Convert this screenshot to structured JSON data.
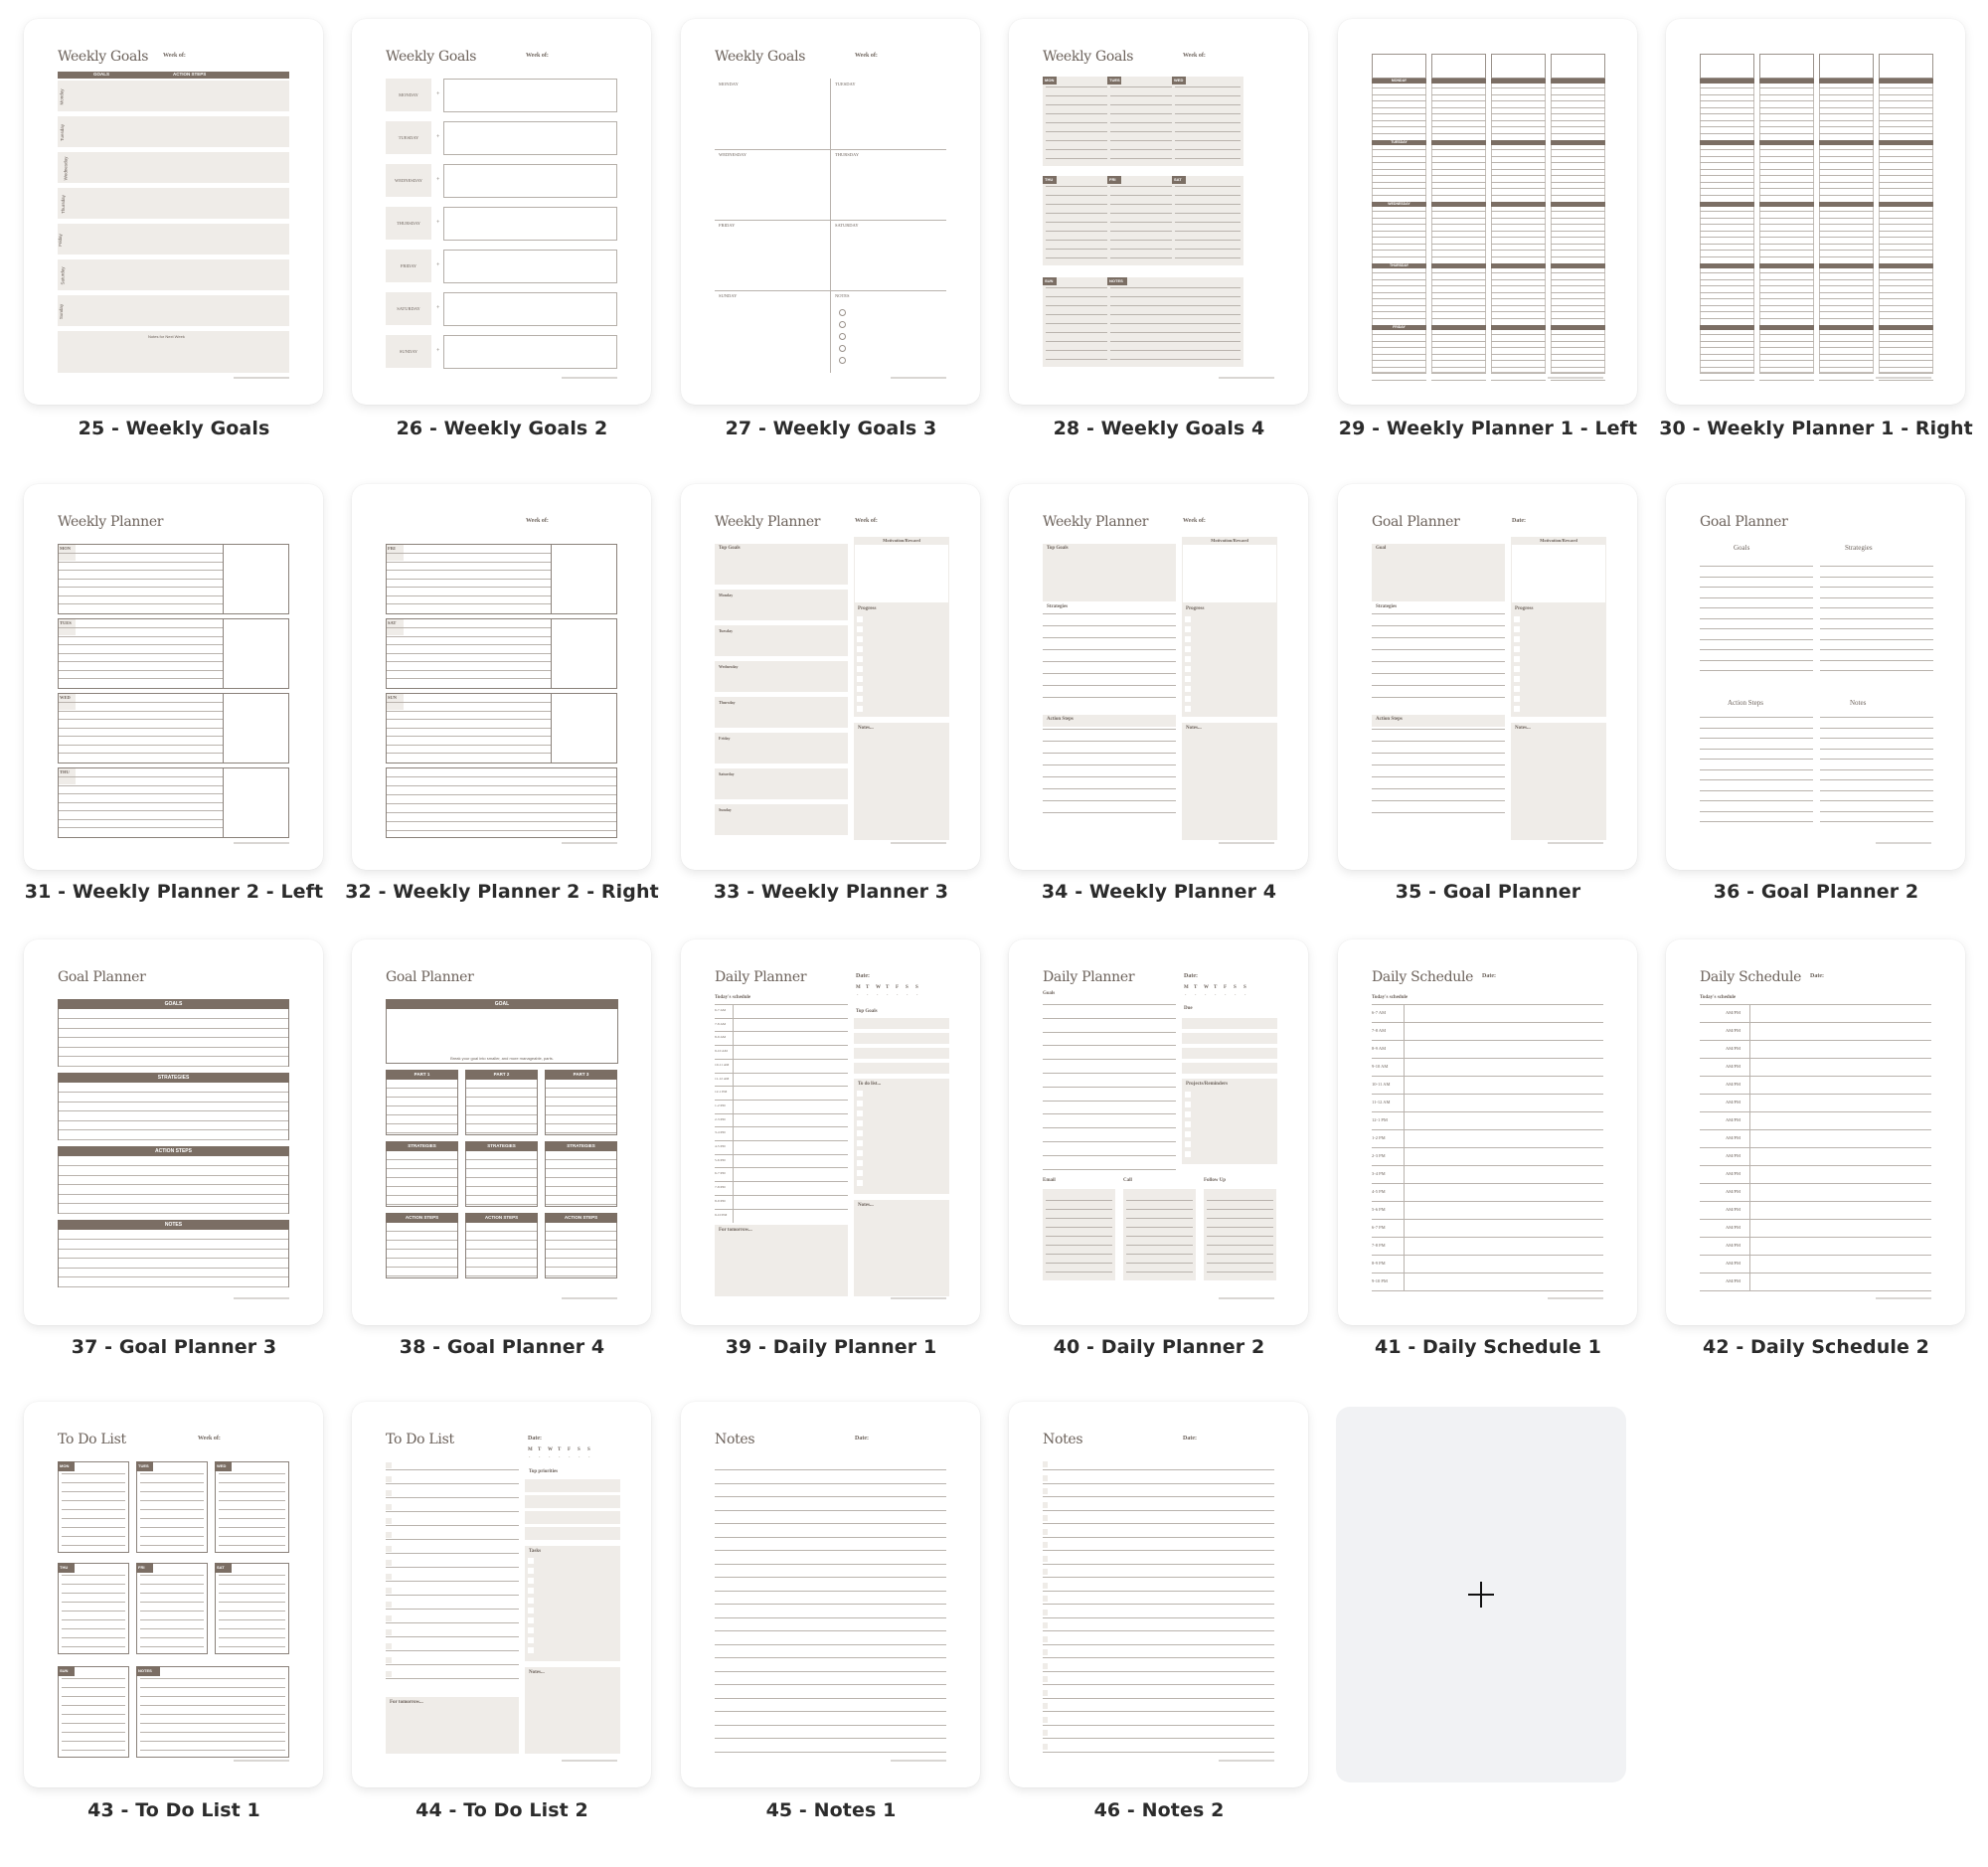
{
  "pages": [
    {
      "number": 25,
      "label": "25 - Weekly Goals",
      "title": "Weekly Goals",
      "meta": "Week of:",
      "headers": [
        "GOALS",
        "ACTION STEPS"
      ],
      "rows": [
        "Monday",
        "Tuesday",
        "Wednesday",
        "Thursday",
        "Friday",
        "Saturday",
        "Sunday"
      ],
      "notes": "Notes for Next Week"
    },
    {
      "number": 26,
      "label": "26 - Weekly Goals 2",
      "title": "Weekly Goals",
      "meta": "Week of:",
      "rows": [
        "MONDAY",
        "TUESDAY",
        "WEDNESDAY",
        "THURSDAY",
        "FRIDAY",
        "SATURDAY",
        "SUNDAY"
      ]
    },
    {
      "number": 27,
      "label": "27 - Weekly Goals 3",
      "title": "Weekly Goals",
      "meta": "Week of:",
      "cells": [
        "MONDAY",
        "TUESDAY",
        "WEDNESDAY",
        "THURSDAY",
        "FRIDAY",
        "SATURDAY",
        "SUNDAY",
        "NOTES"
      ]
    },
    {
      "number": 28,
      "label": "28 - Weekly Goals 4",
      "title": "Weekly Goals",
      "meta": "Week of:",
      "tags": [
        "MON",
        "TUES",
        "WED",
        "THU",
        "FRI",
        "SAT",
        "SUN",
        "NOTES"
      ]
    },
    {
      "number": 29,
      "label": "29 - Weekly Planner 1 - Left",
      "days": [
        "MONDAY",
        "TUESDAY",
        "WEDNESDAY",
        "THURSDAY",
        "FRIDAY"
      ]
    },
    {
      "number": 30,
      "label": "30 - Weekly Planner 1 - Right"
    },
    {
      "number": 31,
      "label": "31 - Weekly Planner 2 - Left",
      "title": "Weekly Planner",
      "days": [
        "MON",
        "TUES",
        "WED",
        "THU"
      ]
    },
    {
      "number": 32,
      "label": "32 - Weekly Planner 2 - Right",
      "meta": "Week of:",
      "days": [
        "FRI",
        "SAT",
        "SUN"
      ]
    },
    {
      "number": 33,
      "label": "33 - Weekly Planner 3",
      "title": "Weekly Planner",
      "meta": "Week of:",
      "sections": [
        "Top Goals",
        "Monday",
        "Tuesday",
        "Wednesday",
        "Thursday",
        "Friday",
        "Saturday",
        "Sunday"
      ],
      "side": [
        "Motivation/Reward",
        "Progress",
        "Notes..."
      ]
    },
    {
      "number": 34,
      "label": "34 - Weekly Planner 4",
      "title": "Weekly Planner",
      "meta": "Week of:",
      "sections": [
        "Top Goals",
        "Strategies",
        "Action Steps"
      ],
      "side": [
        "Motivation/Reward",
        "Progress",
        "Notes..."
      ]
    },
    {
      "number": 35,
      "label": "35 - Goal Planner",
      "title": "Goal Planner",
      "meta": "Date:",
      "sections": [
        "Goal",
        "Strategies",
        "Action Steps"
      ],
      "side": [
        "Motivation/Reward",
        "Progress",
        "Notes..."
      ]
    },
    {
      "number": 36,
      "label": "36 - Goal Planner 2",
      "title": "Goal Planner",
      "columns": [
        "Goals",
        "Strategies",
        "Action Steps",
        "Notes"
      ]
    },
    {
      "number": 37,
      "label": "37 - Goal Planner 3",
      "title": "Goal Planner",
      "headers": [
        "GOALS",
        "STRATEGIES",
        "ACTION STEPS",
        "NOTES"
      ]
    },
    {
      "number": 38,
      "label": "38 - Goal Planner 4",
      "title": "Goal Planner",
      "goal": "GOAL",
      "hint": "Break your goal into smaller, and more manageable, parts.",
      "parts": [
        "PART 1",
        "PART 2",
        "PART 3"
      ],
      "strategies": "STRATEGIES",
      "actions": "ACTION STEPS"
    },
    {
      "number": 39,
      "label": "39 - Daily Planner 1",
      "title": "Daily Planner",
      "meta": "Date:",
      "weekdays": [
        "M",
        "T",
        "W",
        "T",
        "F",
        "S",
        "S"
      ],
      "schedule_label": "Today's schedule",
      "times": [
        "6-7 AM",
        "7-8 AM",
        "8-9 AM",
        "9-10 AM",
        "10-11 AM",
        "11-12 AM",
        "12-1 PM",
        "1-2 PM",
        "2-3 PM",
        "3-4 PM",
        "4-5 PM",
        "5-6 PM",
        "6-7 PM",
        "7-8 PM",
        "8-9 PM",
        "9-10 PM"
      ],
      "side": [
        "Top Goals",
        "To do list...",
        "Notes..."
      ],
      "bottom": "For tomorrow..."
    },
    {
      "number": 40,
      "label": "40 - Daily Planner 2",
      "title": "Daily Planner",
      "meta": "Date:",
      "weekdays": [
        "M",
        "T",
        "W",
        "T",
        "F",
        "S",
        "S"
      ],
      "goals": "Goals",
      "side": [
        "Due",
        "Projects/Reminders"
      ],
      "bottom": [
        "Email",
        "Call",
        "Follow Up"
      ]
    },
    {
      "number": 41,
      "label": "41 - Daily Schedule 1",
      "title": "Daily Schedule",
      "meta": "Date:",
      "schedule_label": "Today's schedule",
      "times": [
        "6-7 AM",
        "7-8 AM",
        "8-9 AM",
        "9-10 AM",
        "10-11 AM",
        "11-12 AM",
        "12-1 PM",
        "1-2 PM",
        "2-3 PM",
        "3-4 PM",
        "4-5 PM",
        "5-6 PM",
        "6-7 PM",
        "7-8 PM",
        "8-9 PM",
        "9-10 PM"
      ]
    },
    {
      "number": 42,
      "label": "42 - Daily Schedule 2",
      "title": "Daily Schedule",
      "meta": "Date:",
      "schedule_label": "Today's schedule",
      "slot": "AM/PM",
      "slots": 16
    },
    {
      "number": 43,
      "label": "43 - To Do List 1",
      "title": "To Do List",
      "meta": "Week of:",
      "tags": [
        "MON",
        "TUES",
        "WED",
        "THU",
        "FRI",
        "SAT",
        "SUN",
        "NOTES"
      ]
    },
    {
      "number": 44,
      "label": "44 - To Do List 2",
      "title": "To Do List",
      "meta": "Date:",
      "weekdays": [
        "M",
        "T",
        "W",
        "T",
        "F",
        "S",
        "S"
      ],
      "side": [
        "Top priorities",
        "Tasks",
        "Notes..."
      ],
      "bottom": "For tomorrow..."
    },
    {
      "number": 45,
      "label": "45 - Notes 1",
      "title": "Notes",
      "meta": "Date:"
    },
    {
      "number": 46,
      "label": "46 - Notes 2",
      "title": "Notes",
      "meta": "Date:"
    }
  ],
  "add_page": {
    "icon": "plus-icon"
  },
  "colors": {
    "accent_brown": "#7b6e64",
    "panel_beige": "#efece8",
    "add_card_bg": "#f1f2f4",
    "label_text": "#2b2b2b"
  }
}
